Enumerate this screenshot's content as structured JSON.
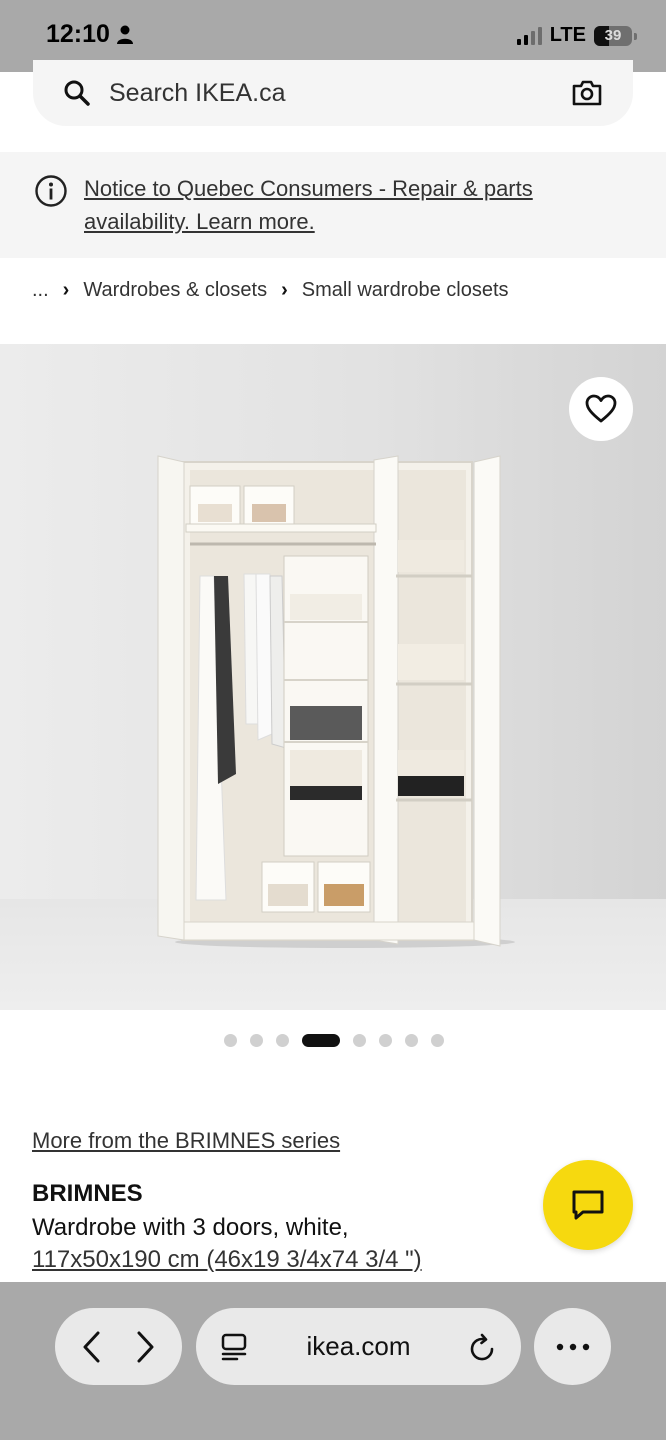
{
  "status_bar": {
    "time": "12:10",
    "network": "LTE",
    "battery": "39"
  },
  "search": {
    "placeholder": "Search IKEA.ca"
  },
  "notice": {
    "line1": "Notice to Quebec Consumers - Repair & parts",
    "line2": "availability. Learn more."
  },
  "breadcrumb": {
    "ellipsis": "...",
    "items": [
      "Wardrobes & closets",
      "Small wardrobe closets"
    ]
  },
  "gallery": {
    "image_count": 8,
    "active_index": 3
  },
  "product": {
    "series_link": "More from the BRIMNES series",
    "name": "BRIMNES",
    "description": "Wardrobe with 3 doors, white,",
    "dimensions": "117x50x190 cm (46x19 3/4x74 3/4 \")"
  },
  "browser": {
    "url": "ikea.com"
  },
  "colors": {
    "chat_button": "#f6d90f",
    "status_bar": "#a9a9a9"
  }
}
